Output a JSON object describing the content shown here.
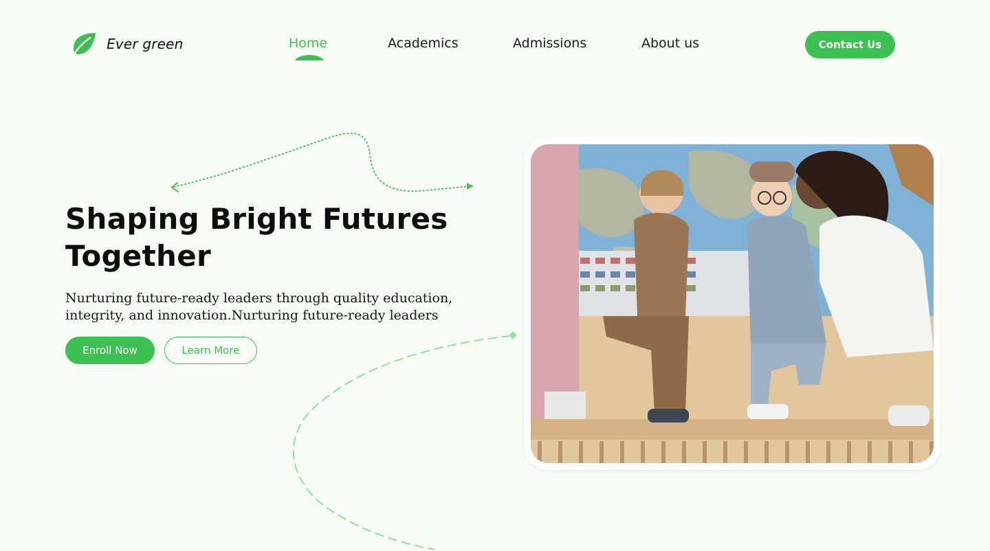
{
  "brand": {
    "name": "Ever green",
    "logo_icon": "leaf-icon",
    "accent": "#3cc052"
  },
  "nav": {
    "items": [
      {
        "label": "Home",
        "active": true
      },
      {
        "label": "Academics",
        "active": false
      },
      {
        "label": "Admissions",
        "active": false
      },
      {
        "label": "About us",
        "active": false
      }
    ],
    "contact_label": "Contact Us"
  },
  "hero": {
    "title_line1": "Shaping Bright Futures",
    "title_line2": "Together",
    "subtitle_line1": "Nurturing future-ready leaders through quality education,",
    "subtitle_line2": "integrity, and innovation.Nurturing future-ready leaders",
    "enroll_label": "Enroll Now",
    "learn_label": "Learn More",
    "image_icon": "children-at-world-map-photo"
  },
  "colors": {
    "background": "#f7fdf4",
    "text": "#111111",
    "primary": "#3cc052"
  }
}
